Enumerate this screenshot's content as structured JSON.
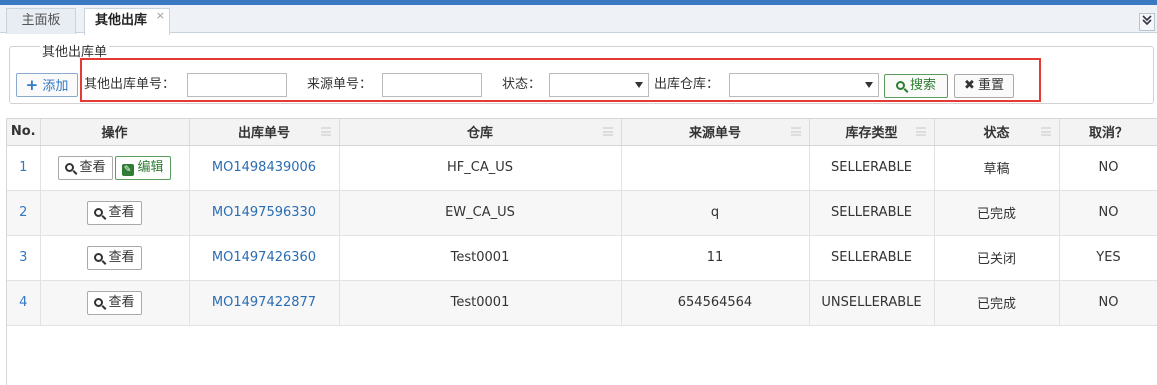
{
  "tabs": [
    {
      "label": "主面板"
    },
    {
      "label": "其他出库",
      "close": "×"
    }
  ],
  "tab_menu_icon": "⌄",
  "filter": {
    "legend": "其他出库单",
    "add_label": "添加",
    "add_icon": "+",
    "fields": {
      "order_no_label": "其他出库单号：",
      "order_no_value": "",
      "source_no_label": "来源单号：",
      "source_no_value": "",
      "status_label": "状态：",
      "status_value": "",
      "warehouse_label": "出库仓库：",
      "warehouse_value": ""
    },
    "search_label": "搜索",
    "reset_label": "重置",
    "reset_icon": "✖"
  },
  "table": {
    "headers": [
      "No.",
      "操作",
      "出库单号",
      "仓库",
      "来源单号",
      "库存类型",
      "状态",
      "取消？"
    ],
    "view_label": "查看",
    "edit_label": "编辑",
    "rows": [
      {
        "no": "1",
        "order_no": "MO1498439006",
        "warehouse": "HF_CA_US",
        "source_no": "",
        "stock_type": "SELLERABLE",
        "status": "草稿",
        "cancel": "NO"
      },
      {
        "no": "2",
        "order_no": "MO1497596330",
        "warehouse": "EW_CA_US",
        "source_no": "q",
        "stock_type": "SELLERABLE",
        "status": "已完成",
        "cancel": "NO"
      },
      {
        "no": "3",
        "order_no": "MO1497426360",
        "warehouse": "Test0001",
        "source_no": "11",
        "stock_type": "SELLERABLE",
        "status": "已关闭",
        "cancel": "YES"
      },
      {
        "no": "4",
        "order_no": "MO1497422877",
        "warehouse": "Test0001",
        "source_no": "654564564",
        "stock_type": "UNSELLERABLE",
        "status": "已完成",
        "cancel": "NO"
      }
    ]
  },
  "colors": {
    "accent": "#3a78c2",
    "highlight": "#e53935",
    "success": "#2e7d32"
  }
}
